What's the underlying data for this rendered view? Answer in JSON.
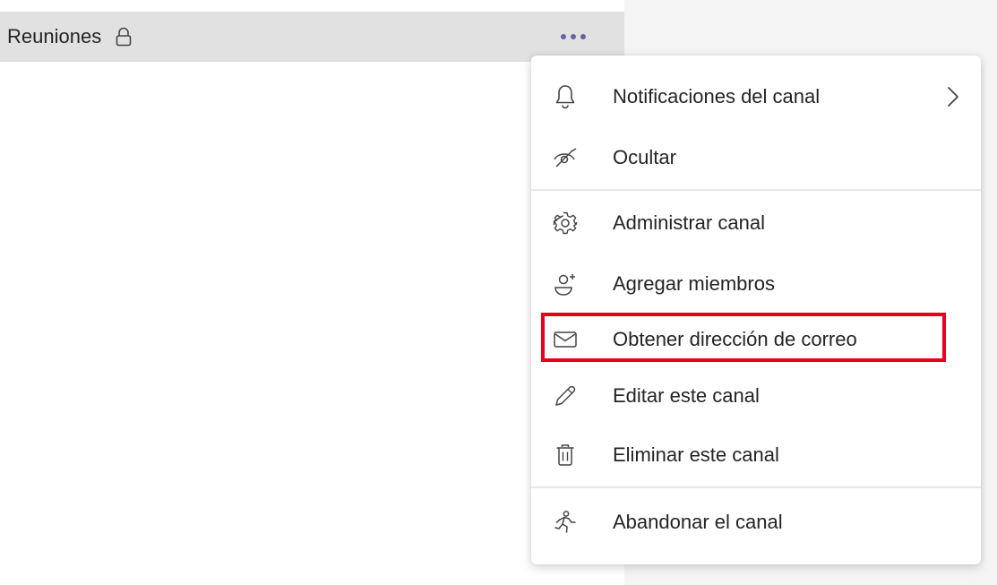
{
  "channel": {
    "name": "Reuniones",
    "lock_icon": "lock-icon",
    "more_icon": "more-options-icon"
  },
  "colors": {
    "row_bg": "#e1e1e1",
    "accent": "#6264a7",
    "highlight": "#e8001c",
    "text": "#252424"
  },
  "menu": {
    "items": [
      {
        "label": "Notificaciones del canal",
        "icon": "bell-icon",
        "submenu": true
      },
      {
        "label": "Ocultar",
        "icon": "hide-eye-icon"
      },
      {
        "label": "Administrar canal",
        "icon": "gear-icon"
      },
      {
        "label": "Agregar miembros",
        "icon": "add-person-icon"
      },
      {
        "label": "Obtener dirección de correo",
        "icon": "mail-icon",
        "highlighted": true
      },
      {
        "label": "Editar este canal",
        "icon": "pencil-icon"
      },
      {
        "label": "Eliminar este canal",
        "icon": "trash-icon"
      },
      {
        "label": "Abandonar el canal",
        "icon": "leave-icon"
      }
    ]
  }
}
